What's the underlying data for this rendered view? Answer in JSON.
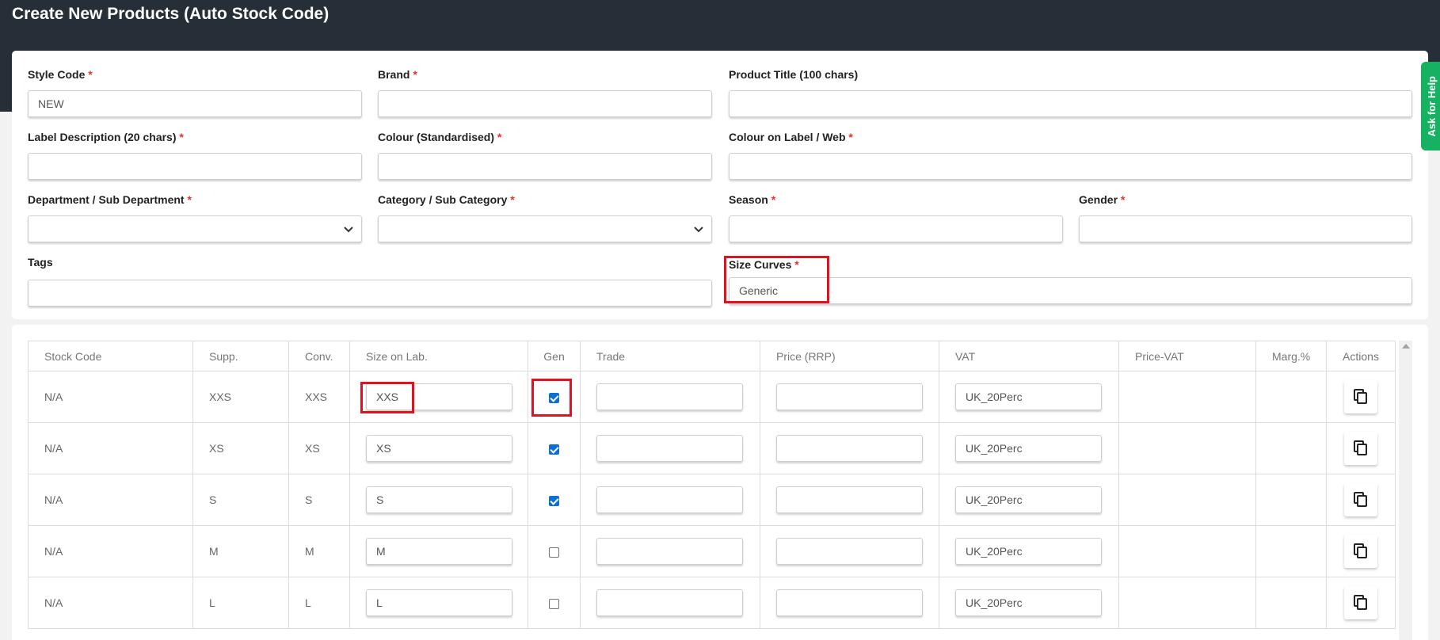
{
  "page": {
    "title": "Create New Products (Auto Stock Code)"
  },
  "help": {
    "label": "Ask for Help"
  },
  "required_mark": "*",
  "form": {
    "style_code": {
      "label": "Style Code",
      "value": "NEW"
    },
    "brand": {
      "label": "Brand",
      "value": ""
    },
    "product_title": {
      "label": "Product Title (100 chars)",
      "value": ""
    },
    "label_description": {
      "label": "Label Description (20 chars)",
      "value": ""
    },
    "colour_standardised": {
      "label": "Colour (Standardised)",
      "value": ""
    },
    "colour_on_label": {
      "label": "Colour on Label / Web",
      "value": ""
    },
    "department": {
      "label": "Department / Sub Department",
      "value": ""
    },
    "category": {
      "label": "Category / Sub Category",
      "value": ""
    },
    "season": {
      "label": "Season",
      "value": ""
    },
    "gender": {
      "label": "Gender",
      "value": ""
    },
    "tags": {
      "label": "Tags",
      "value": ""
    },
    "size_curves": {
      "label": "Size Curves",
      "value": "Generic"
    }
  },
  "table": {
    "headers": {
      "stock_code": "Stock Code",
      "supp": "Supp.",
      "conv": "Conv.",
      "size_on_lab": "Size on Lab.",
      "gen": "Gen",
      "trade": "Trade",
      "price_rrp": "Price (RRP)",
      "vat": "VAT",
      "price_vat": "Price-VAT",
      "marg": "Marg.%",
      "actions": "Actions"
    },
    "rows": [
      {
        "stock_code": "N/A",
        "supp": "XXS",
        "conv": "XXS",
        "size_on_lab": "XXS",
        "gen": true,
        "trade": "",
        "price_rrp": "",
        "vat": "UK_20Perc",
        "price_vat": "",
        "marg": ""
      },
      {
        "stock_code": "N/A",
        "supp": "XS",
        "conv": "XS",
        "size_on_lab": "XS",
        "gen": true,
        "trade": "",
        "price_rrp": "",
        "vat": "UK_20Perc",
        "price_vat": "",
        "marg": ""
      },
      {
        "stock_code": "N/A",
        "supp": "S",
        "conv": "S",
        "size_on_lab": "S",
        "gen": true,
        "trade": "",
        "price_rrp": "",
        "vat": "UK_20Perc",
        "price_vat": "",
        "marg": ""
      },
      {
        "stock_code": "N/A",
        "supp": "M",
        "conv": "M",
        "size_on_lab": "M",
        "gen": false,
        "trade": "",
        "price_rrp": "",
        "vat": "UK_20Perc",
        "price_vat": "",
        "marg": ""
      },
      {
        "stock_code": "N/A",
        "supp": "L",
        "conv": "L",
        "size_on_lab": "L",
        "gen": false,
        "trade": "",
        "price_rrp": "",
        "vat": "UK_20Perc",
        "price_vat": "",
        "marg": ""
      }
    ]
  },
  "icons": {
    "select_arrow": "chevron-down-icon",
    "row_action": "copy-icon",
    "scroll": "scroll-up-arrow-icon"
  },
  "colors": {
    "header_bg": "#262e38",
    "required": "#e0322b",
    "highlight": "#e0121f",
    "help_tab": "#16b262",
    "checkbox": "#0b6fd6"
  }
}
